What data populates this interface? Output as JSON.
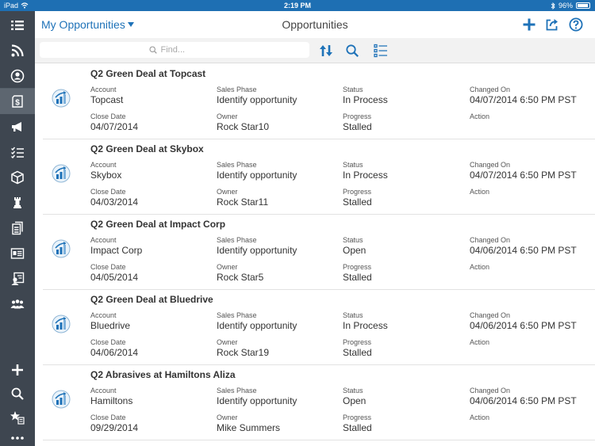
{
  "status_bar": {
    "device": "iPad",
    "time": "2:19 PM",
    "battery": "96%"
  },
  "header": {
    "view_selector": "My Opportunities",
    "title": "Opportunities"
  },
  "toolbar": {
    "search_placeholder": "Find..."
  },
  "colors": {
    "accent": "#1e72b8",
    "sidebar": "#3e4650",
    "status_bar": "#1e6fb3"
  },
  "sidebar": {
    "items": [
      {
        "icon": "list-icon"
      },
      {
        "icon": "feed-icon"
      },
      {
        "icon": "person-icon"
      },
      {
        "icon": "opportunity-dollar-icon",
        "active": true
      },
      {
        "icon": "megaphone-icon"
      },
      {
        "icon": "tasks-icon"
      },
      {
        "icon": "box-icon"
      },
      {
        "icon": "chess-rook-icon"
      },
      {
        "icon": "documents-icon"
      },
      {
        "icon": "id-card-icon"
      },
      {
        "icon": "contact-card-icon"
      },
      {
        "icon": "group-icon"
      }
    ],
    "bottom_items": [
      {
        "icon": "plus-icon"
      },
      {
        "icon": "search-icon"
      },
      {
        "icon": "favorites-icon"
      },
      {
        "icon": "more-icon"
      }
    ]
  },
  "labels": {
    "account": "Account",
    "sales_phase": "Sales Phase",
    "status": "Status",
    "changed_on": "Changed On",
    "close_date": "Close Date",
    "owner": "Owner",
    "progress": "Progress",
    "action": "Action"
  },
  "opportunities": [
    {
      "title": "Q2 Green Deal at Topcast",
      "account": "Topcast",
      "sales_phase": "Identify opportunity",
      "status": "In Process",
      "changed_on": "04/07/2014 6:50 PM PST",
      "close_date": "04/07/2014",
      "owner": "Rock Star10",
      "progress": "Stalled",
      "action": ""
    },
    {
      "title": "Q2 Green Deal at Skybox",
      "account": "Skybox",
      "sales_phase": "Identify opportunity",
      "status": "In Process",
      "changed_on": "04/07/2014 6:50 PM PST",
      "close_date": "04/03/2014",
      "owner": "Rock Star11",
      "progress": "Stalled",
      "action": ""
    },
    {
      "title": "Q2 Green Deal at Impact Corp",
      "account": "Impact Corp",
      "sales_phase": "Identify opportunity",
      "status": "Open",
      "changed_on": "04/06/2014 6:50 PM PST",
      "close_date": "04/05/2014",
      "owner": "Rock Star5",
      "progress": "Stalled",
      "action": ""
    },
    {
      "title": "Q2 Green Deal at Bluedrive",
      "account": "Bluedrive",
      "sales_phase": "Identify opportunity",
      "status": "In Process",
      "changed_on": "04/06/2014 6:50 PM PST",
      "close_date": "04/06/2014",
      "owner": "Rock Star19",
      "progress": "Stalled",
      "action": ""
    },
    {
      "title": "Q2 Abrasives at Hamiltons Aliza",
      "account": "Hamiltons",
      "sales_phase": "Identify opportunity",
      "status": "Open",
      "changed_on": "04/06/2014 6:50 PM PST",
      "close_date": "09/29/2014",
      "owner": "Mike Summers",
      "progress": "Stalled",
      "action": ""
    }
  ]
}
